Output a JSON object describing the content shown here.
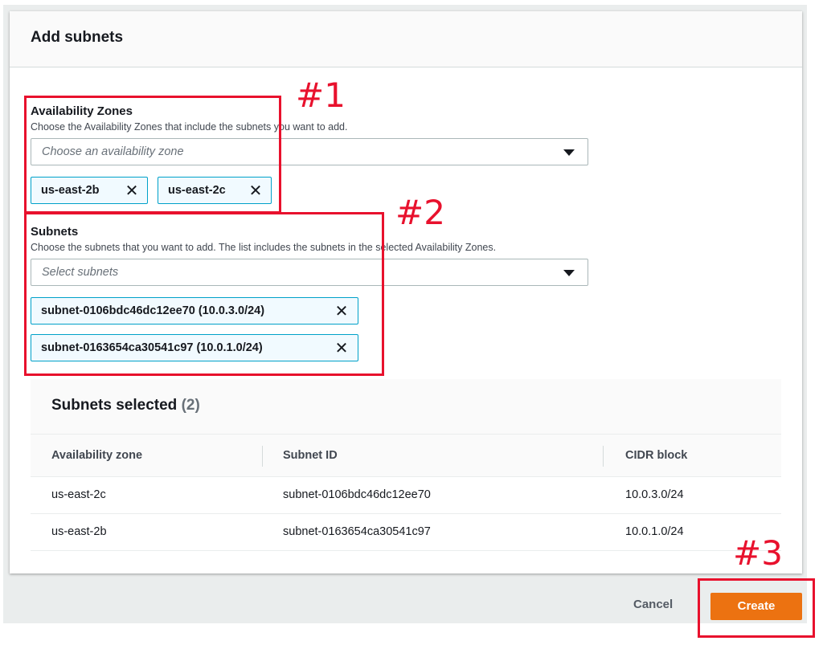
{
  "dialog": {
    "title": "Add subnets"
  },
  "availability_zones": {
    "label": "Availability Zones",
    "description": "Choose the Availability Zones that include the subnets you want to add.",
    "placeholder": "Choose an availability zone",
    "tokens": [
      "us-east-2b",
      "us-east-2c"
    ]
  },
  "subnets": {
    "label": "Subnets",
    "description": "Choose the subnets that you want to add. The list includes the subnets in the selected Availability Zones.",
    "placeholder": "Select subnets",
    "tokens": [
      "subnet-0106bdc46dc12ee70 (10.0.3.0/24)",
      "subnet-0163654ca30541c97 (10.0.1.0/24)"
    ]
  },
  "table": {
    "title": "Subnets selected",
    "count": "(2)",
    "columns": [
      "Availability zone",
      "Subnet ID",
      "CIDR block"
    ],
    "rows": [
      [
        "us-east-2c",
        "subnet-0106bdc46dc12ee70",
        "10.0.3.0/24"
      ],
      [
        "us-east-2b",
        "subnet-0163654ca30541c97",
        "10.0.1.0/24"
      ]
    ]
  },
  "footer": {
    "cancel_label": "Cancel",
    "create_label": "Create"
  },
  "callouts": [
    "#1",
    "#2",
    "#3"
  ],
  "colors": {
    "accent": "#ec7211",
    "callout": "#e8112d",
    "token_border": "#00a1c9"
  }
}
